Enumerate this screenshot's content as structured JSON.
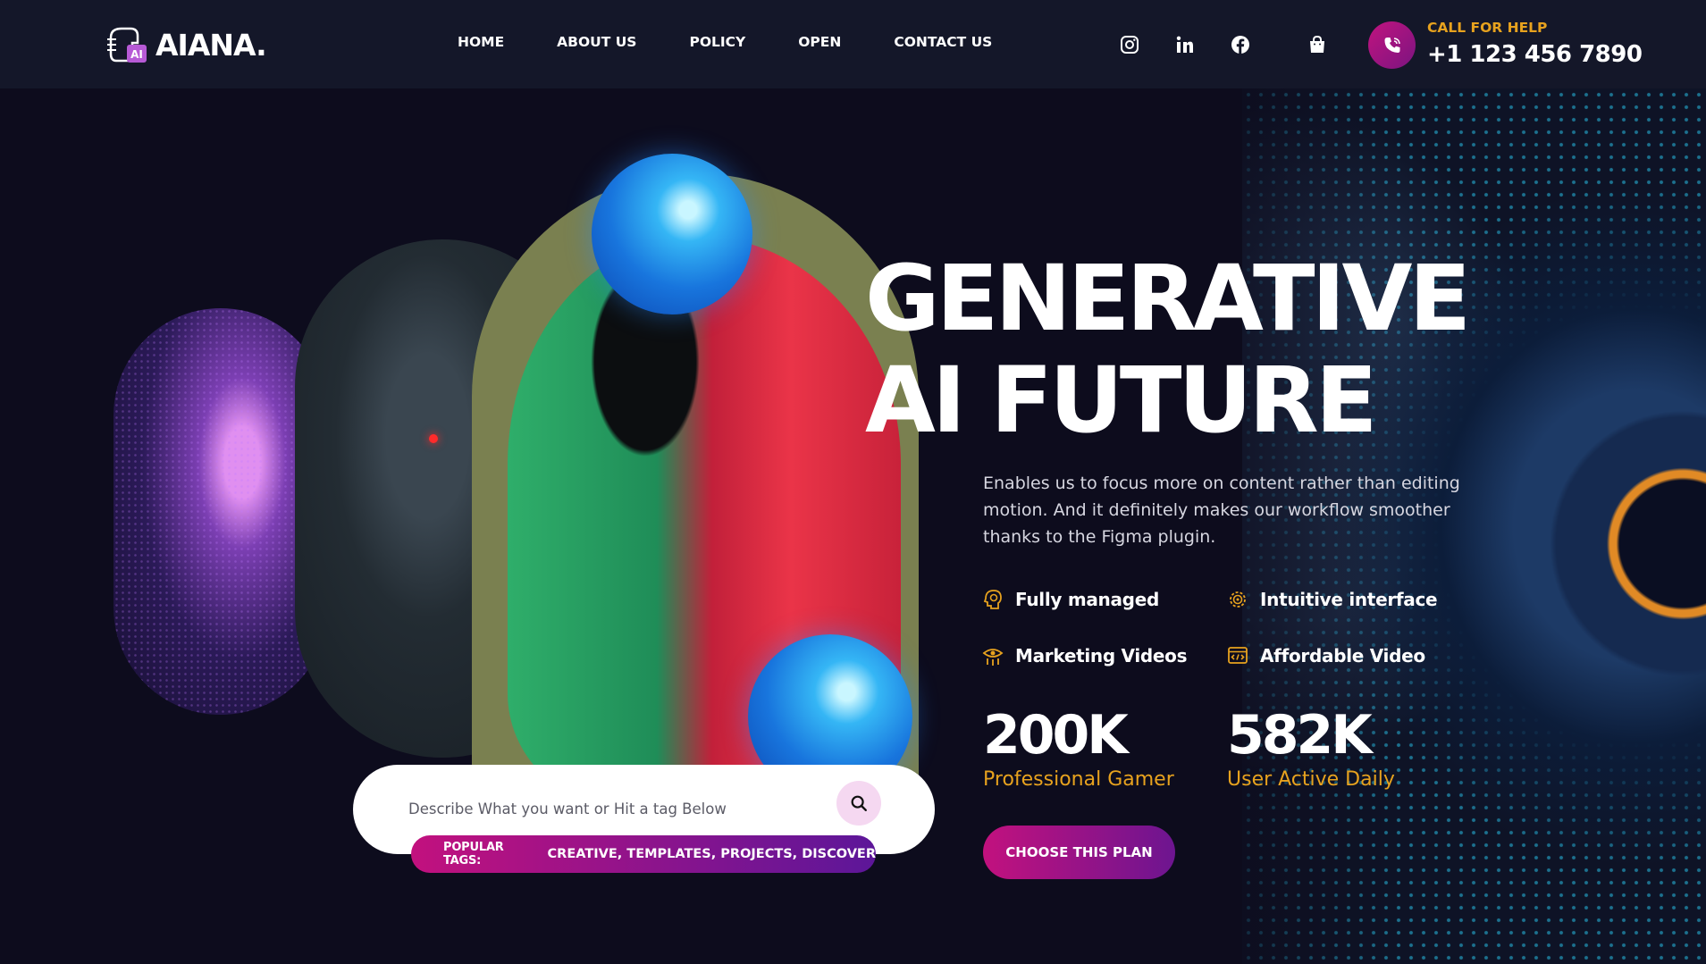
{
  "brand": {
    "name": "AIANA.",
    "logo_icon": "robot-head-ai-logo",
    "logo_badge": "AI"
  },
  "nav": {
    "items": [
      "HOME",
      "ABOUT US",
      "POLICY",
      "OPEN",
      "CONTACT US"
    ]
  },
  "header": {
    "socials": [
      "instagram-icon",
      "linkedin-icon",
      "facebook-icon"
    ],
    "cart_icon": "shopping-bag-icon",
    "call_icon": "phone-call-icon",
    "call_label": "CALL FOR HELP",
    "call_number": "+1 123 456 7890"
  },
  "hero": {
    "title_line1": "GENERATIVE",
    "title_line2": "AI FUTURE",
    "description": "Enables us to focus more on content rather than editing motion. And it definitely makes our workflow smoother thanks to the Figma plugin.",
    "features": [
      {
        "label": "Fully managed",
        "icon": "brain-head-icon"
      },
      {
        "label": "Intuitive interface",
        "icon": "gear-brain-icon"
      },
      {
        "label": "Marketing Videos",
        "icon": "robot-eye-icon"
      },
      {
        "label": "Affordable Video",
        "icon": "code-window-icon"
      }
    ],
    "stats": [
      {
        "value": "200K",
        "caption": "Professional Gamer"
      },
      {
        "value": "582K",
        "caption": "User Active Daily"
      }
    ],
    "cta_label": "CHOOSE THIS PLAN"
  },
  "search": {
    "placeholder": "Describe What you want or Hit a tag Below",
    "button_icon": "search-icon",
    "tags_label": "POPULAR TAGS:",
    "tags_value": "CREATIVE, TEMPLATES, PROJECTS, DISCOVER"
  },
  "colors": {
    "background": "#0d0c1d",
    "header": "#141729",
    "accent_orange": "#e7a21e",
    "gradient_start": "#c2117e",
    "gradient_end": "#6d1590"
  }
}
